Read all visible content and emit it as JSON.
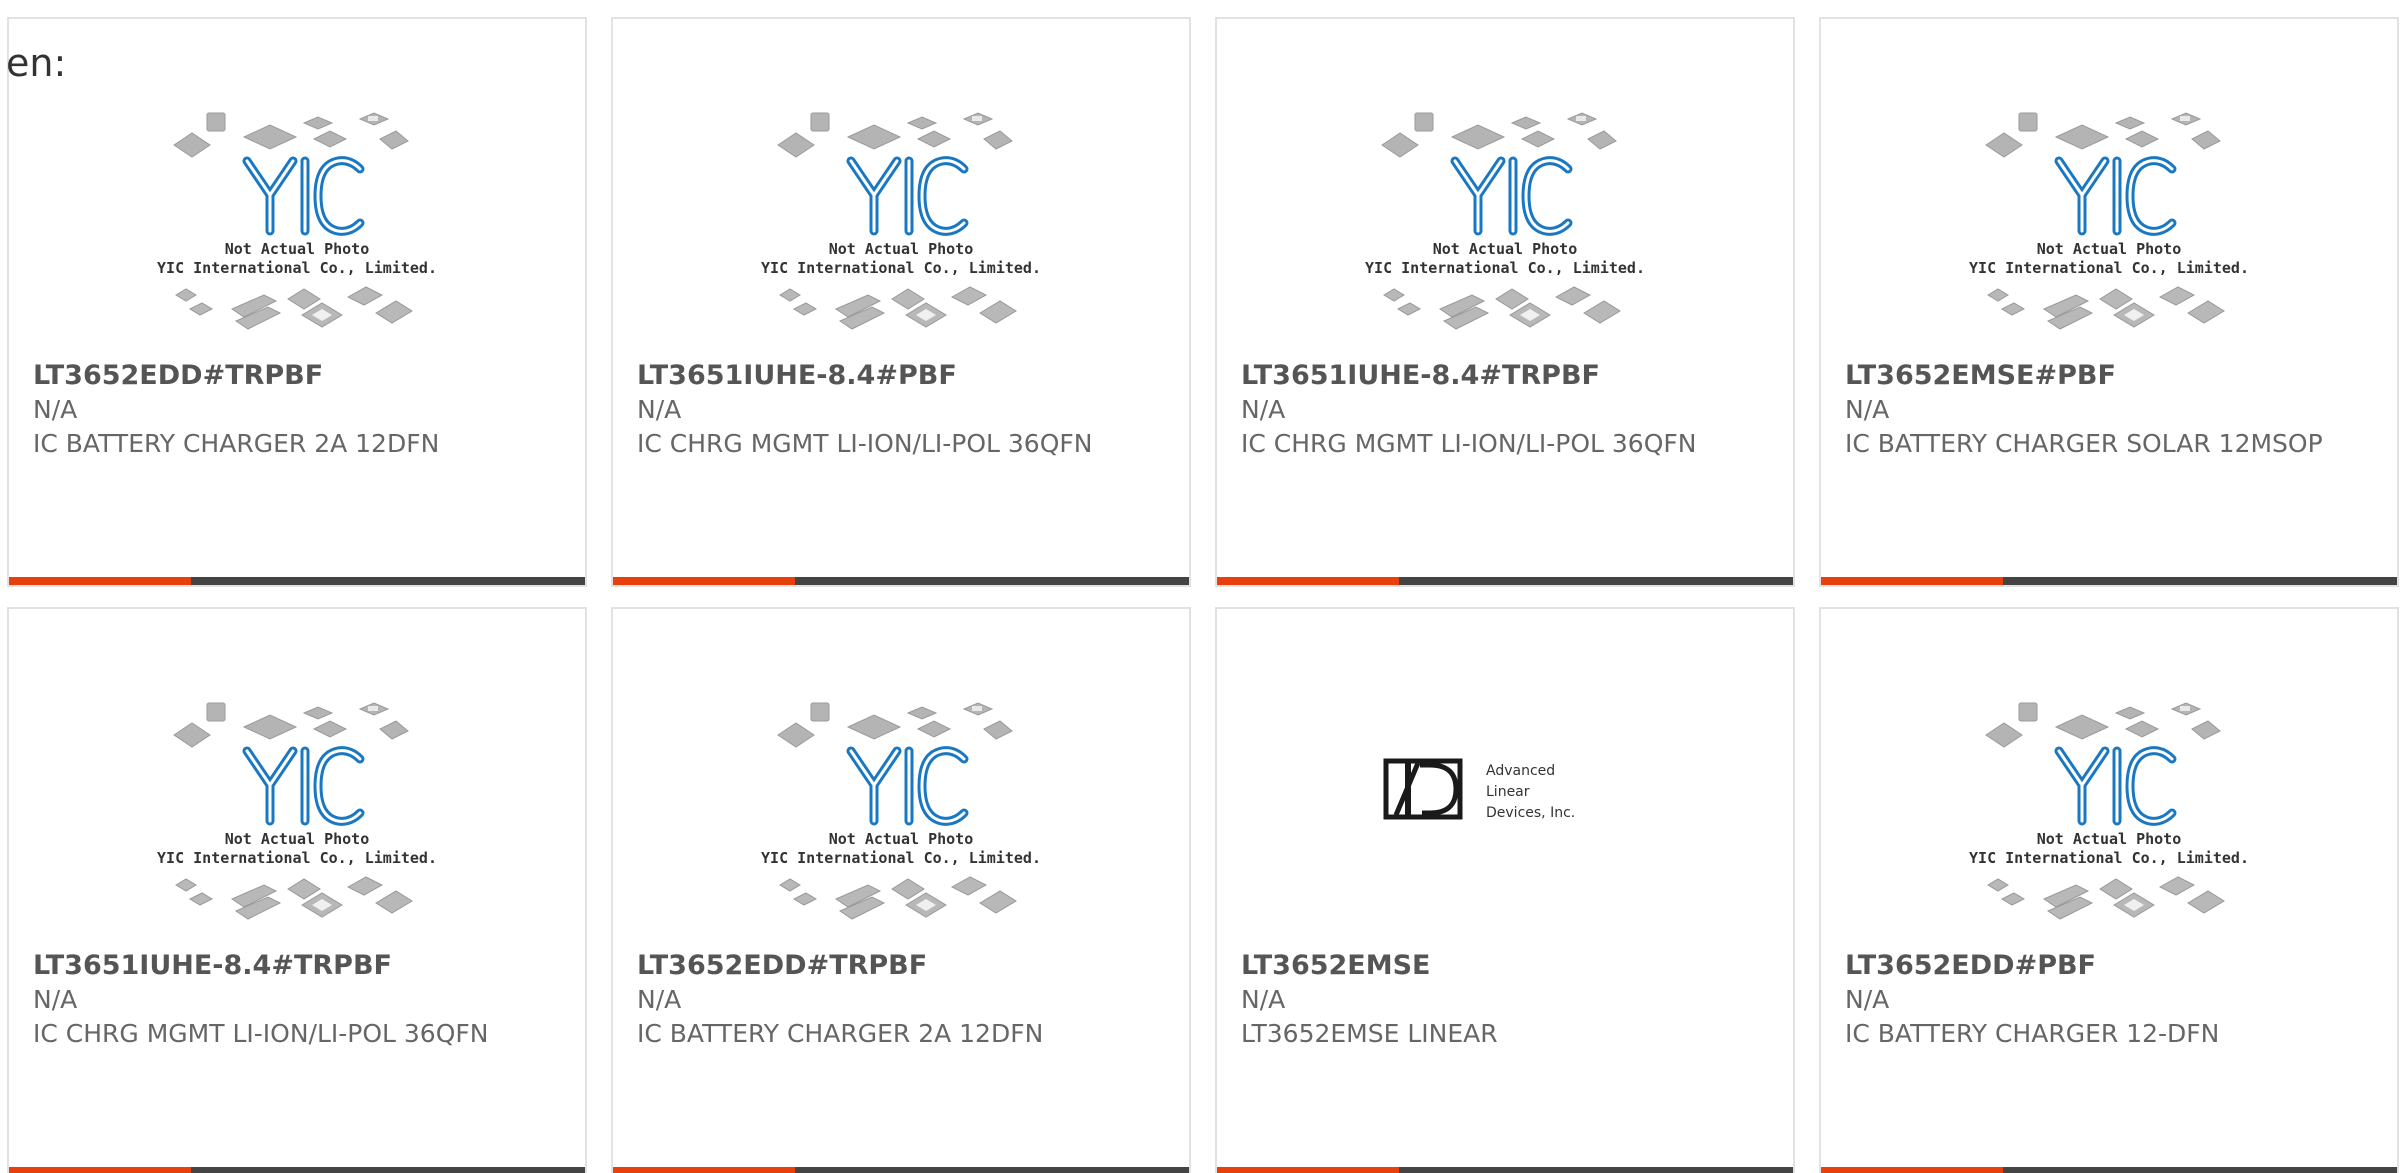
{
  "language_label": "en:",
  "colors": {
    "accent": "#e8400c",
    "bar": "#444444",
    "text": "#555555",
    "yic_blue": "#1a78c2"
  },
  "placeholder": {
    "line1": "Not Actual Photo",
    "line2": "YIC International Co., Limited."
  },
  "alternate_logo": {
    "line1": "Advanced",
    "line2": "Linear",
    "line3": "Devices, Inc."
  },
  "products": [
    {
      "part": "LT3652EDD#TRPBF",
      "manufacturer": "N/A",
      "description": "IC BATTERY CHARGER 2A 12DFN",
      "image": "yic-placeholder"
    },
    {
      "part": "LT3651IUHE-8.4#PBF",
      "manufacturer": "N/A",
      "description": "IC CHRG MGMT LI-ION/LI-POL 36QFN",
      "image": "yic-placeholder"
    },
    {
      "part": "LT3651IUHE-8.4#TRPBF",
      "manufacturer": "N/A",
      "description": "IC CHRG MGMT LI-ION/LI-POL 36QFN",
      "image": "yic-placeholder"
    },
    {
      "part": "LT3652EMSE#PBF",
      "manufacturer": "N/A",
      "description": "IC BATTERY CHARGER SOLAR 12MSOP",
      "image": "yic-placeholder"
    },
    {
      "part": "LT3651IUHE-8.4#TRPBF",
      "manufacturer": "N/A",
      "description": "IC CHRG MGMT LI-ION/LI-POL 36QFN",
      "image": "yic-placeholder"
    },
    {
      "part": "LT3652EDD#TRPBF",
      "manufacturer": "N/A",
      "description": "IC BATTERY CHARGER 2A 12DFN",
      "image": "yic-placeholder"
    },
    {
      "part": "LT3652EMSE",
      "manufacturer": "N/A",
      "description": "LT3652EMSE LINEAR",
      "image": "ald-logo"
    },
    {
      "part": "LT3652EDD#PBF",
      "manufacturer": "N/A",
      "description": "IC BATTERY CHARGER 12-DFN",
      "image": "yic-placeholder"
    }
  ]
}
